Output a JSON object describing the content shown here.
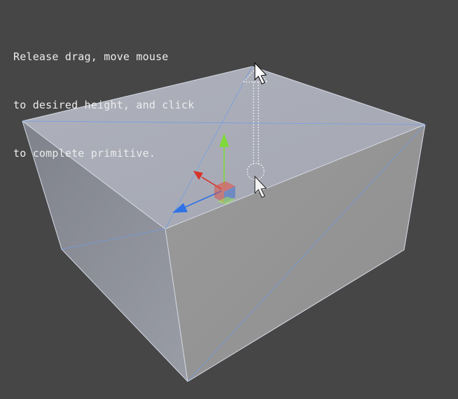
{
  "instruction": {
    "lines": [
      "Release drag, move mouse",
      "to desired height, and click",
      "to complete primitive."
    ]
  },
  "viewport": {
    "background_color": "#464646",
    "text_color": "#ececec"
  },
  "primitive": {
    "type": "box",
    "top_face_color": "#a9acb7",
    "front_face_color": "#969696",
    "left_face_color": "#888b94",
    "right_face_color": "#9c9c9c",
    "wire_color": "#6f9ce8"
  },
  "gizmo": {
    "x_axis_color": "#d8322a",
    "y_axis_color": "#7fd93a",
    "z_axis_color": "#2f72e6",
    "icons": [
      "x-axis-arrow-icon",
      "y-axis-arrow-icon",
      "z-axis-arrow-icon",
      "move-plane-handle-icon"
    ]
  },
  "cursors": [
    "mouse-pointer-icon",
    "mouse-pointer-icon"
  ]
}
